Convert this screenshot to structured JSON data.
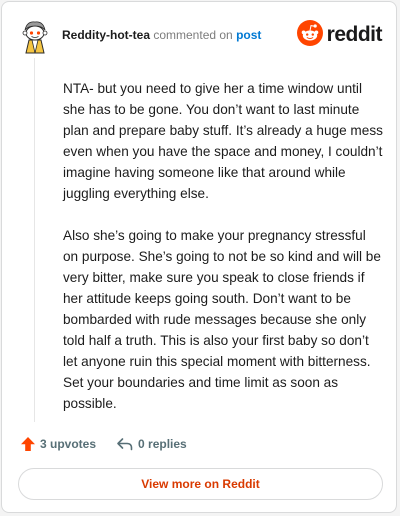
{
  "comment": {
    "author": "Reddity-hot-tea",
    "action_text": "commented on",
    "target_link": "post",
    "paragraphs": [
      "NTA- but you need to give her a time window until she has to be gone. You don’t want to last minute plan and prepare baby stuff. It’s already a huge mess even when you have the space and money, I couldn’t imagine having someone like that around while juggling everything else.",
      "Also she’s going to make your pregnancy stressful on purpose. She’s going to not be so kind and will be very bitter, make sure you speak to close friends if her attitude keeps going south. Don’t want to be bombarded with rude messages because she only told half a truth. This is also your first baby so don’t let anyone ruin this special moment with bitterness. Set your boundaries and time limit as soon as possible."
    ]
  },
  "brand": {
    "name": "reddit",
    "icon": "snoo-icon",
    "accent": "#ff4500"
  },
  "stats": {
    "upvotes": "3 upvotes",
    "replies": "0 replies",
    "upvote_icon": "upvote-arrow-icon",
    "reply_icon": "reply-arrow-icon",
    "upvote_color": "#ff4500"
  },
  "footer": {
    "view_more_label": "View more on Reddit",
    "view_more_color": "#d93a00"
  }
}
